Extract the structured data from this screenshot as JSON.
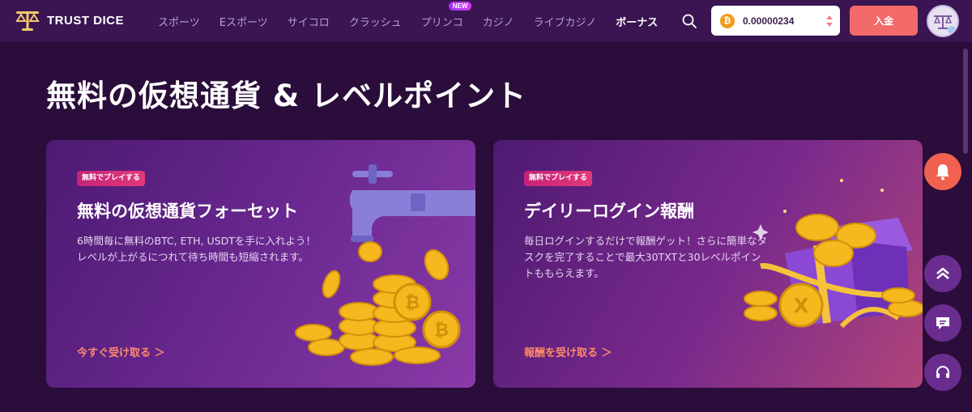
{
  "brand": {
    "name": "TRUST DICE"
  },
  "nav": {
    "items": [
      {
        "label": "スポーツ"
      },
      {
        "label": "Eスポーツ"
      },
      {
        "label": "サイコロ"
      },
      {
        "label": "クラッシュ"
      },
      {
        "label": "プリンコ",
        "badge": "NEW"
      },
      {
        "label": "カジノ"
      },
      {
        "label": "ライブカジノ"
      },
      {
        "label": "ボーナス",
        "active": true
      }
    ]
  },
  "wallet": {
    "coin_symbol": "₿",
    "balance": "0.00000234"
  },
  "header": {
    "deposit_label": "入金"
  },
  "page": {
    "title": "無料の仮想通貨 & レベルポイント"
  },
  "cards": [
    {
      "tag": "無料でプレイする",
      "title": "無料の仮想通貨フォーセット",
      "description": "6時間毎に無料のBTC, ETH, USDTを手に入れよう！レベルが上がるにつれて待ち時間も短縮されます。",
      "link": "今すぐ受け取る ＞"
    },
    {
      "tag": "無料でプレイする",
      "title": "デイリーログイン報酬",
      "description": "毎日ログインするだけで報酬ゲット！さらに簡単なタスクを完了することで最大30TXTと30レベルポイントももらえます。",
      "link": "報酬を受け取る ＞"
    }
  ],
  "colors": {
    "background": "#2a0d3a",
    "header": "#3a1552",
    "accent": "#f26a6a",
    "link": "#ff8a6a",
    "tag": "#e23a78",
    "coin": "#f5b81e"
  },
  "icons": {
    "search": "search-icon",
    "bell": "bell-icon",
    "scroll_top": "chevrons-up-icon",
    "chat": "chat-icon",
    "support": "headset-icon"
  }
}
